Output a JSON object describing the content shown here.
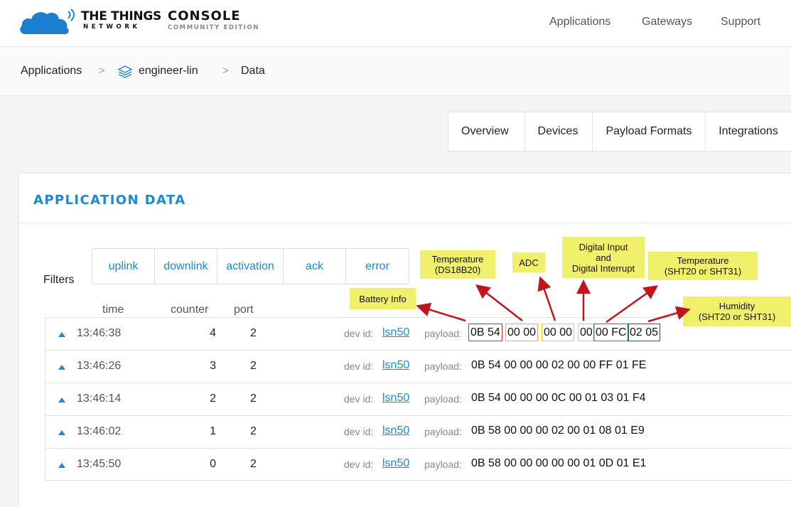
{
  "brand": {
    "ttn_line1": "THE THINGS",
    "ttn_line2": "NETWORK",
    "console_line1": "CONSOLE",
    "console_line2": "COMMUNITY EDITION",
    "accent": "#1e88d3"
  },
  "topnav": {
    "applications": "Applications",
    "gateways": "Gateways",
    "support": "Support"
  },
  "breadcrumb": {
    "root": "Applications",
    "app": "engineer-lin",
    "page": "Data",
    "separator": ">"
  },
  "tabs": [
    "Overview",
    "Devices",
    "Payload Formats",
    "Integrations"
  ],
  "card": {
    "title": "APPLICATION DATA",
    "filters_label": "Filters",
    "filters": [
      "uplink",
      "downlink",
      "activation",
      "ack",
      "error"
    ],
    "columns": {
      "time": "time",
      "counter": "counter",
      "port": "port"
    }
  },
  "rows": [
    {
      "time": "13:46:38",
      "counter": "4",
      "port": "2",
      "dev_label": "dev id:",
      "dev_id": "lsn50",
      "payload_label": "payload:",
      "payload": "0B 54 00 00 00 00 00 00 FC 02 05"
    },
    {
      "time": "13:46:26",
      "counter": "3",
      "port": "2",
      "dev_label": "dev id:",
      "dev_id": "lsn50",
      "payload_label": "payload:",
      "payload": "0B 54 00 00 00 02 00 00 FF 01 FE"
    },
    {
      "time": "13:46:14",
      "counter": "2",
      "port": "2",
      "dev_label": "dev id:",
      "dev_id": "lsn50",
      "payload_label": "payload:",
      "payload": "0B 54 00 00 00 0C 00 01 03 01 F4"
    },
    {
      "time": "13:46:02",
      "counter": "1",
      "port": "2",
      "dev_label": "dev id:",
      "dev_id": "lsn50",
      "payload_label": "payload:",
      "payload": "0B 58 00 00 00 02 00 01 08 01 E9"
    },
    {
      "time": "13:45:50",
      "counter": "0",
      "port": "2",
      "dev_label": "dev id:",
      "dev_id": "lsn50",
      "payload_label": "payload:",
      "payload": "0B 58 00 00 00 00 00 01 0D 01 E1"
    }
  ],
  "payload_segments": [
    {
      "text": "0B 54",
      "color": "#d32f2f"
    },
    {
      "text": "00 00",
      "color": "#f4a460"
    },
    {
      "text": "00 00",
      "color": "#e8d21a"
    },
    {
      "text": "00",
      "color": "#a5d6a7"
    },
    {
      "text": "00 FC",
      "color": "#2e7d99"
    },
    {
      "text": "02 05",
      "color": "#4a3a7a"
    }
  ],
  "annotations": {
    "battery": "Battery Info",
    "temp_ds_1": "Temperature",
    "temp_ds_2": "(DS18B20)",
    "adc": "ADC",
    "digital_1": "Digital Input",
    "digital_2": "and",
    "digital_3": "Digital Interrupt",
    "temp_sht_1": "Temperature",
    "temp_sht_2": "(SHT20 or SHT31)",
    "hum_1": "Humidity",
    "hum_2": "(SHT20 or SHT31)",
    "note_bg": "#f1f06b",
    "arrow_color": "#c0161b"
  }
}
